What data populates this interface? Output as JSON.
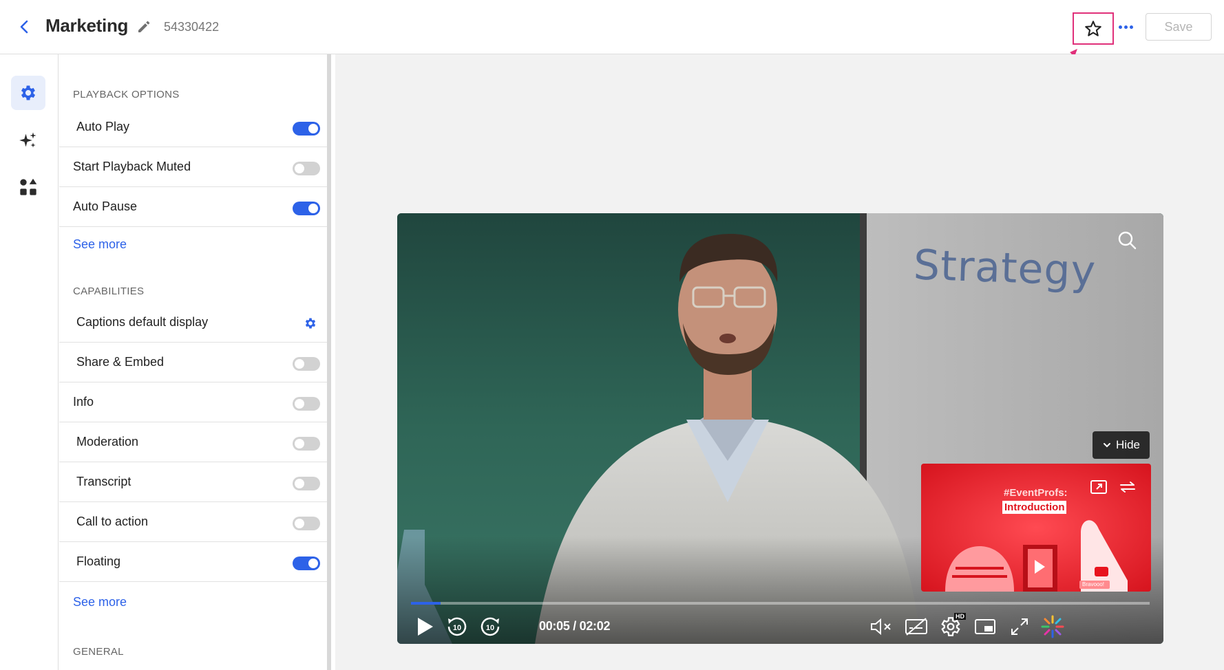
{
  "header": {
    "title": "Marketing",
    "video_id": "54330422",
    "save_label": "Save"
  },
  "panel": {
    "playback_title": "PLAYBACK OPTIONS",
    "playback_rows": [
      {
        "label": "Auto Play",
        "state": "on"
      },
      {
        "label": "Start Playback Muted",
        "state": "off"
      },
      {
        "label": "Auto Pause",
        "state": "on"
      }
    ],
    "see_more_1": "See more",
    "capabilities_title": "CAPABILITIES",
    "capability_rows": [
      {
        "label": "Captions default display",
        "state": "gear"
      },
      {
        "label": "Share & Embed",
        "state": "off"
      },
      {
        "label": "Info",
        "state": "off"
      },
      {
        "label": "Moderation",
        "state": "off"
      },
      {
        "label": "Transcript",
        "state": "off"
      },
      {
        "label": "Call to action",
        "state": "off"
      },
      {
        "label": "Floating",
        "state": "on"
      }
    ],
    "see_more_2": "See more",
    "general_title": "GENERAL"
  },
  "player": {
    "whiteboard_text": "Strategy",
    "hide_label": "Hide",
    "float_title": "#EventProfs:",
    "float_subtitle": "Introduction",
    "float_badge": "Bravooo!",
    "time": "00:05 / 02:02",
    "progress_fraction": 0.04,
    "hd_badge": "HD"
  },
  "colors": {
    "accent": "#2d62e8",
    "highlight": "#e0307a"
  }
}
